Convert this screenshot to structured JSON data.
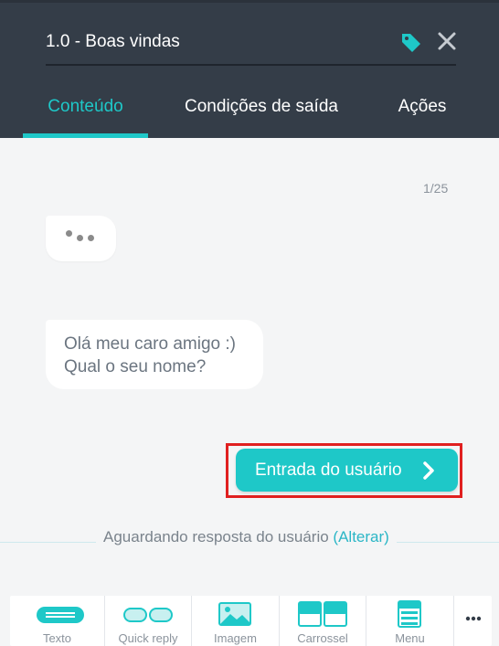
{
  "header": {
    "title": "1.0 - Boas vindas",
    "tag_icon": "tag-icon",
    "close_icon": "close-icon"
  },
  "tabs": [
    {
      "label": "Conteúdo",
      "active": true
    },
    {
      "label": "Condições de saída",
      "active": false
    },
    {
      "label": "Ações",
      "active": false
    }
  ],
  "content": {
    "counter": "1/25",
    "typing_indicator": "typing-dots-icon",
    "message": {
      "line1": "Olá meu caro amigo :)",
      "line2": "Qual o seu nome?"
    },
    "user_input_button": "Entrada do usuário",
    "waiting_text": "Aguardando resposta do usuário",
    "waiting_link": "(Alterar)"
  },
  "toolbar": {
    "items": [
      {
        "label": "Texto",
        "icon": "text-icon"
      },
      {
        "label": "Quick reply",
        "icon": "quick-reply-icon"
      },
      {
        "label": "Imagem",
        "icon": "image-icon"
      },
      {
        "label": "Carrossel",
        "icon": "carousel-icon"
      },
      {
        "label": "Menu",
        "icon": "menu-icon"
      }
    ],
    "more_icon": "more-icon"
  },
  "colors": {
    "header_bg": "#343d48",
    "accent": "#1ec8c8",
    "content_bg": "#f4f5f6",
    "highlight_border": "#e02020"
  }
}
